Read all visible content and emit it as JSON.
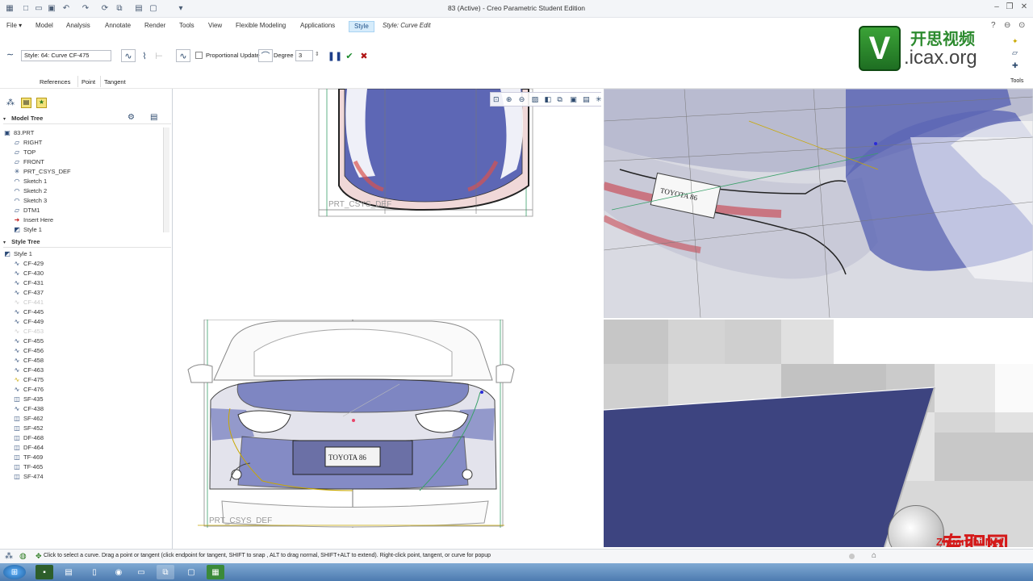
{
  "window": {
    "title": "83 (Active) - Creo Parametric Student Edition"
  },
  "tabs": [
    {
      "label": "File",
      "has_dropdown": true
    },
    {
      "label": "Model"
    },
    {
      "label": "Analysis"
    },
    {
      "label": "Annotate"
    },
    {
      "label": "Render"
    },
    {
      "label": "Tools"
    },
    {
      "label": "View"
    },
    {
      "label": "Flexible Modeling"
    },
    {
      "label": "Applications"
    },
    {
      "label": "Style",
      "active": true
    },
    {
      "label": "Style: Curve Edit",
      "italic": true
    }
  ],
  "ribbon": {
    "curve_field": "Style: 64: Curve   CF-475",
    "proportional_update_label": "Proportional Update",
    "degree_label": "Degree",
    "degree_value": "3",
    "subtabs": [
      "References",
      "Point",
      "Tangent"
    ],
    "tools_label": "Tools"
  },
  "watermark": {
    "brand_cn": "开思视频",
    "brand_url": ".icax.org",
    "corner_cn": "专职网",
    "corner_url": "Zhuanzhi.Net"
  },
  "model_tree": {
    "title": "Model Tree",
    "items": [
      {
        "label": "83.PRT",
        "icon": "part-icon"
      },
      {
        "label": "RIGHT",
        "icon": "datum-plane-icon"
      },
      {
        "label": "TOP",
        "icon": "datum-plane-icon"
      },
      {
        "label": "FRONT",
        "icon": "datum-plane-icon"
      },
      {
        "label": "PRT_CSYS_DEF",
        "icon": "csys-icon"
      },
      {
        "label": "Sketch 1",
        "icon": "sketch-icon"
      },
      {
        "label": "Sketch 2",
        "icon": "sketch-icon"
      },
      {
        "label": "Sketch 3",
        "icon": "sketch-icon"
      },
      {
        "label": "DTM1",
        "icon": "datum-plane-icon"
      },
      {
        "label": "Insert Here",
        "icon": "insert-arrow-icon"
      },
      {
        "label": "Style 1",
        "icon": "style-icon"
      }
    ]
  },
  "style_tree": {
    "title": "Style Tree",
    "items": [
      {
        "label": "Style 1",
        "icon": "style-icon"
      },
      {
        "label": "CF-429",
        "icon": "curve-icon"
      },
      {
        "label": "CF-430",
        "icon": "curve-icon"
      },
      {
        "label": "CF-431",
        "icon": "curve-icon"
      },
      {
        "label": "CF-437",
        "icon": "curve-icon"
      },
      {
        "label": "CF-441",
        "icon": "curve-icon",
        "dim": true
      },
      {
        "label": "CF-445",
        "icon": "curve-icon"
      },
      {
        "label": "CF-449",
        "icon": "curve-icon"
      },
      {
        "label": "CF-453",
        "icon": "curve-icon",
        "dim": true
      },
      {
        "label": "CF-455",
        "icon": "curve-icon"
      },
      {
        "label": "CF-456",
        "icon": "curve-icon"
      },
      {
        "label": "CF-458",
        "icon": "curve-icon"
      },
      {
        "label": "CF-463",
        "icon": "curve-icon"
      },
      {
        "label": "CF-475",
        "icon": "curve-edit-icon"
      },
      {
        "label": "CF-476",
        "icon": "curve-icon"
      },
      {
        "label": "SF-435",
        "icon": "surface-icon"
      },
      {
        "label": "CF-438",
        "icon": "curve-icon"
      },
      {
        "label": "SF-462",
        "icon": "surface-icon"
      },
      {
        "label": "SF-452",
        "icon": "surface-icon"
      },
      {
        "label": "DF-468",
        "icon": "surface-icon"
      },
      {
        "label": "DF-464",
        "icon": "surface-icon"
      },
      {
        "label": "TF-469",
        "icon": "surface-icon"
      },
      {
        "label": "TF-465",
        "icon": "surface-icon"
      },
      {
        "label": "SF-474",
        "icon": "surface-icon"
      }
    ]
  },
  "viewports": {
    "top_left_label": "PRT_CSYS_DEF",
    "bottom_left_label": "PRT_CSYS_DEF",
    "plate_text": "TOYOTA 86"
  },
  "status": {
    "message": "Click to select a curve. Drag a point or tangent (click endpoint for tangent, SHIFT to snap , ALT to drag normal, SHIFT+ALT to extend). Right-click point, tangent, or curve for popup"
  },
  "colors": {
    "accent": "#d6ecfb",
    "body_blue": "#5d67b5",
    "surface_navy": "#3d4480"
  }
}
